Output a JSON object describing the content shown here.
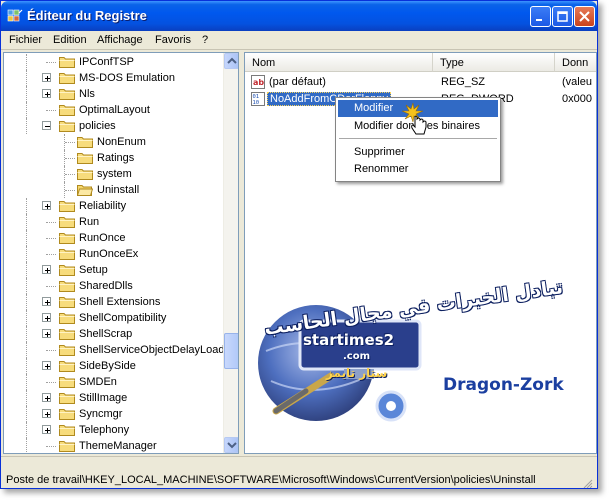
{
  "window": {
    "title": "Éditeur du Registre",
    "app_icon": "registry-editor-icon",
    "controls": [
      "minimize-icon",
      "maximize-icon",
      "close-icon"
    ]
  },
  "menu": [
    "Fichier",
    "Edition",
    "Affichage",
    "Favoris",
    "?"
  ],
  "tree": {
    "items": [
      {
        "label": "IPConfTSP",
        "expandable": false
      },
      {
        "label": "MS-DOS Emulation",
        "expandable": true
      },
      {
        "label": "Nls",
        "expandable": true
      },
      {
        "label": "OptimalLayout",
        "expandable": false
      },
      {
        "label": "policies",
        "expandable": true,
        "expanded": true
      },
      {
        "label": "NonEnum",
        "expandable": false,
        "child": true
      },
      {
        "label": "Ratings",
        "expandable": false,
        "child": true
      },
      {
        "label": "system",
        "expandable": false,
        "child": true
      },
      {
        "label": "Uninstall",
        "expandable": false,
        "child": true,
        "open": true
      },
      {
        "label": "Reliability",
        "expandable": true
      },
      {
        "label": "Run",
        "expandable": false
      },
      {
        "label": "RunOnce",
        "expandable": false
      },
      {
        "label": "RunOnceEx",
        "expandable": false
      },
      {
        "label": "Setup",
        "expandable": true
      },
      {
        "label": "SharedDlls",
        "expandable": false
      },
      {
        "label": "Shell Extensions",
        "expandable": true
      },
      {
        "label": "ShellCompatibility",
        "expandable": true
      },
      {
        "label": "ShellScrap",
        "expandable": true
      },
      {
        "label": "ShellServiceObjectDelayLoad",
        "expandable": false
      },
      {
        "label": "SideBySide",
        "expandable": true
      },
      {
        "label": "SMDEn",
        "expandable": false
      },
      {
        "label": "StillImage",
        "expandable": true
      },
      {
        "label": "Syncmgr",
        "expandable": true
      },
      {
        "label": "Telephony",
        "expandable": true
      },
      {
        "label": "ThemeManager",
        "expandable": false
      }
    ]
  },
  "list": {
    "columns": [
      "Nom",
      "Type",
      "Donn"
    ],
    "rows": [
      {
        "name": "(par défaut)",
        "type": "REG_SZ",
        "data": "(valeu",
        "icon": "string-value-icon"
      },
      {
        "name": "NoAddFromCDorFloppy",
        "type": "REG_DWORD",
        "data": "0x000",
        "icon": "dword-value-icon",
        "selected": true
      }
    ]
  },
  "context_menu": {
    "items": [
      "Modifier",
      "Modifier données binaires",
      "Supprimer",
      "Renommer"
    ],
    "highlighted": "Modifier"
  },
  "status": {
    "path": "Poste de travail\\HKEY_LOCAL_MACHINE\\SOFTWARE\\Microsoft\\Windows\\CurrentVersion\\policies\\Uninstall"
  },
  "watermark": {
    "arabic_title": "تبادل الخبرات في مجال الحاسب",
    "brand": "startimes2",
    "brand_tld": ".com",
    "brand_ar": "ستار تايمز",
    "author": "Dragon-Zork"
  },
  "colors": {
    "titlebar": "#0058ee",
    "selection": "#316ac5",
    "author": "#1b3fa0"
  }
}
